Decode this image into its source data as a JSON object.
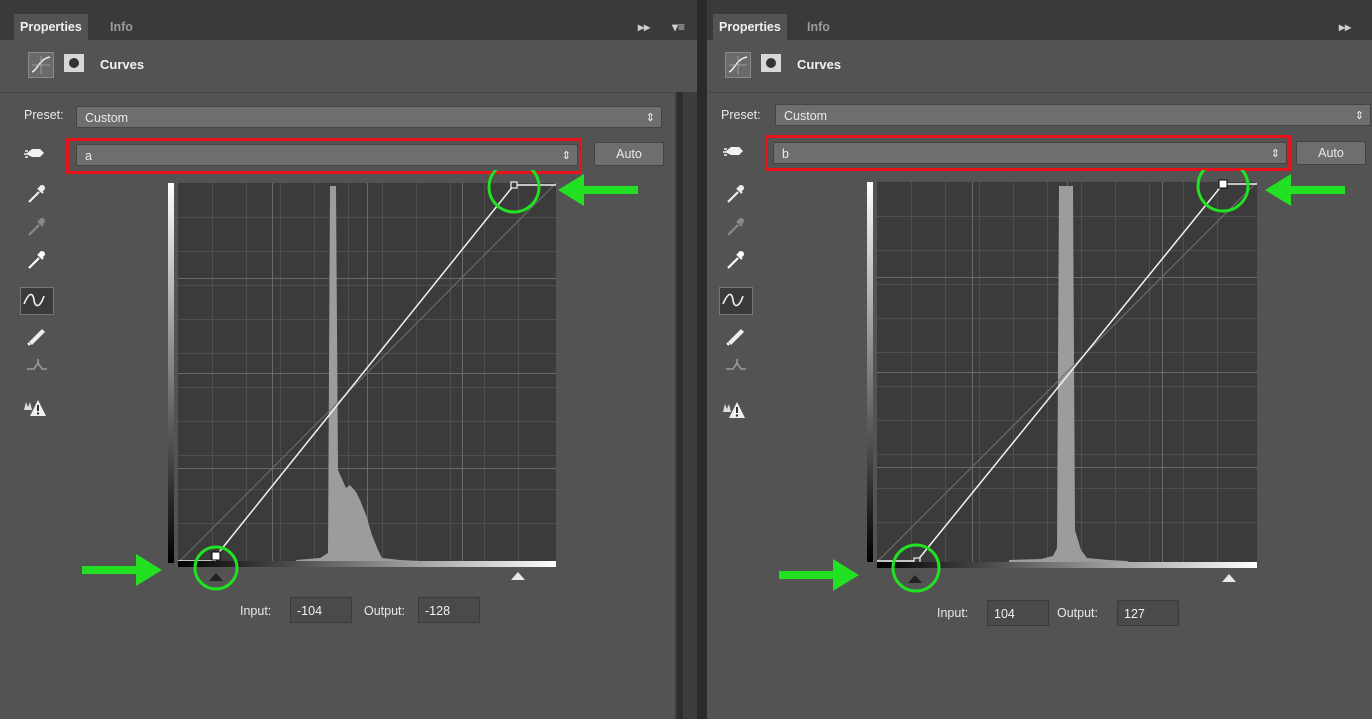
{
  "panels": [
    {
      "tabs": {
        "properties": "Properties",
        "info": "Info"
      },
      "header_title": "Curves",
      "preset_label": "Preset:",
      "preset_value": "Custom",
      "channel_value": "a",
      "auto_label": "Auto",
      "input_label": "Input:",
      "input_value": "-104",
      "output_label": "Output:",
      "output_value": "-128",
      "histogram": "narrow spike near center with shoulder on right"
    },
    {
      "tabs": {
        "properties": "Properties",
        "info": "Info"
      },
      "header_title": "Curves",
      "preset_label": "Preset:",
      "preset_value": "Custom",
      "channel_value": "b",
      "auto_label": "Auto",
      "input_label": "Input:",
      "input_value": "104",
      "output_label": "Output:",
      "output_value": "127",
      "histogram": "narrow spike right of center"
    }
  ],
  "icons": {
    "curves_adjustment": "curves-adjustment-icon",
    "layer_mask": "layer-mask-icon",
    "targeted_adjustment": "hand-targeted-adjust-icon",
    "black_point": "black-eyedropper-icon",
    "gray_point": "gray-eyedropper-icon",
    "white_point": "white-eyedropper-icon",
    "edit_points": "curve-points-icon",
    "draw": "pencil-icon",
    "smooth": "smooth-curve-icon",
    "clipping": "clipping-warning-icon",
    "annotation_circle": "green-circle-highlight",
    "annotation_arrow": "green-arrow-pointer"
  },
  "colors": {
    "panel_bg": "#535353",
    "graph_bg": "#3b3b3b",
    "highlight_red": "#e8141b",
    "annotation_green": "#22e022"
  }
}
